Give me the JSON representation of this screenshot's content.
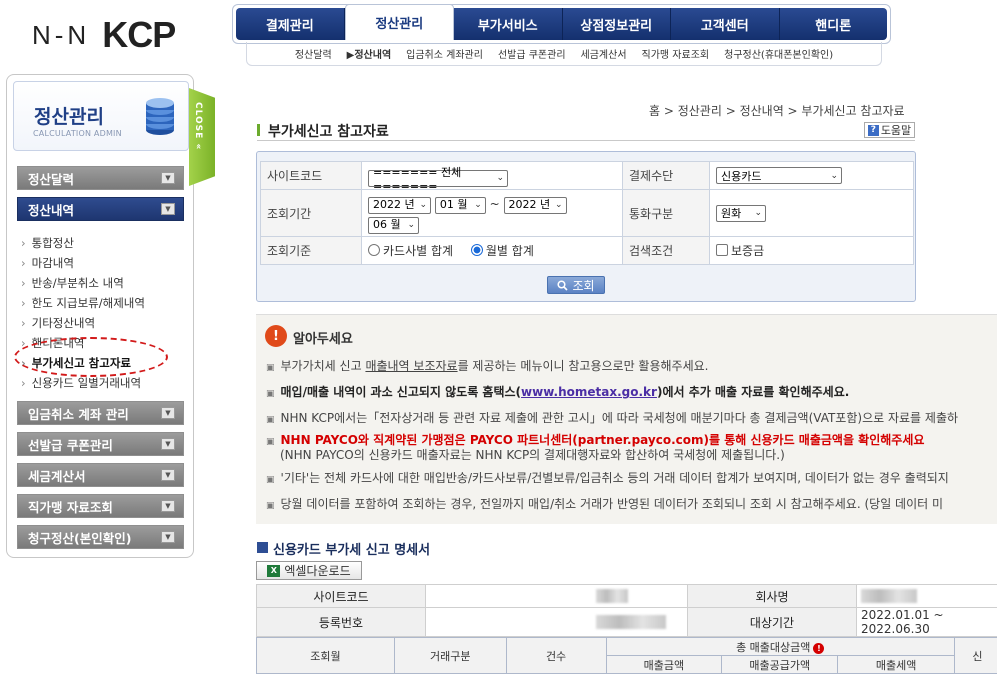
{
  "header": {
    "logo_left": "N-N",
    "logo_right": "KCP",
    "gnb": [
      "결제관리",
      "정산관리",
      "부가서비스",
      "상점정보관리",
      "고객센터",
      "핸디론"
    ],
    "sub_nav": [
      "정산달력",
      "▶정산내역",
      "입금취소 계좌관리",
      "선발급 쿠폰관리",
      "세금계산서",
      "직가맹 자료조회",
      "청구정산(휴대폰본인확인)"
    ]
  },
  "sidebar": {
    "title": "정산관리",
    "subtitle": "CALCULATION ADMIN",
    "close_label": "CLOSE",
    "close_arrow": "«",
    "menu": [
      "정산달력",
      "정산내역",
      "입금취소 계좌 관리",
      "선발급 쿠폰관리",
      "세금계산서",
      "직가맹 자료조회",
      "청구정산(본인확인)"
    ],
    "sub_items": [
      "통합정산",
      "마감내역",
      "반송/부분취소 내역",
      "한도 지급보류/해제내역",
      "기타정산내역",
      "핸디론내역",
      "부가세신고 참고자료",
      "신용카드 일별거래내역"
    ]
  },
  "main": {
    "breadcrumb": "홈 > 정산관리 > 정산내역 > 부가세신고 참고자료",
    "page_title": "부가세신고 참고자료",
    "help_label": "도움말",
    "search": {
      "site_code_label": "사이트코드",
      "site_code_value": "======= 전체 =======",
      "payment_label": "결제수단",
      "payment_value": "신용카드",
      "period_label": "조회기간",
      "start_year": "2022 년",
      "start_month": "01 월",
      "tilde": "~",
      "end_year": "2022 년",
      "end_month": "06 월",
      "currency_label": "통화구분",
      "currency_value": "원화",
      "basis_label": "조회기준",
      "basis_card": "카드사별 합계",
      "basis_month": "월별 합계",
      "condition_label": "검색조건",
      "deposit_label": "보증금",
      "search_button": "조회"
    },
    "notice": {
      "icon": "!",
      "title": "알아두세요",
      "l1a": "부가가치세 신고 ",
      "l1b": "매출내역 보조자료",
      "l1c": "를 제공하는 메뉴이니 참고용으로만 활용해주세요.",
      "l2a": "매입/매출 내역이 과소 신고되지 않도록 홈택스(",
      "l2b": "www.hometax.go.kr",
      "l2c": ")에서 추가 매출 자료를 확인해주세요.",
      "l3": "NHN KCP에서는「전자상거래 등 관련 자료 제출에 관한 고시」에 따라 국세청에 매분기마다 총 결제금액(VAT포함)으로 자료를 제출하",
      "l4": "NHN PAYCO와 직계약된 가맹점은 PAYCO 파트너센터(partner.payco.com)를 통해 신용카드 매출금액을 확인해주세요",
      "l5": "(NHN PAYCO의 신용카드 매출자료는 NHN KCP의 결제대행자료와 합산하여 국세청에 제출됩니다.)",
      "l6": "'기타'는 전체 카드사에 대한 매입반송/카드사보류/건별보류/입금취소 등의 거래 데이터 합계가 보여지며, 데이터가 없는 경우 출력되지",
      "l7": "당월 데이터를 포함하여 조회하는 경우, 전일까지 매입/취소 거래가 반영된 데이터가 조회되니 조회 시 참고해주세요. (당일 데이터 미"
    },
    "report": {
      "title": "신용카드 부가세 신고 명세서",
      "excel_button": "엑셀다운로드",
      "site_code_label": "사이트코드",
      "company_label": "회사명",
      "reg_no_label": "등록번호",
      "period_label": "대상기간",
      "period_value": "2022.01.01 ~ 2022.06.30",
      "col_month": "조회월",
      "col_type": "거래구분",
      "col_count": "건수",
      "col_total": "총 매출대상금액",
      "col_amount": "매출금액",
      "col_supply": "매출공급가액",
      "col_tax": "매출세액",
      "col_last": "신"
    }
  }
}
